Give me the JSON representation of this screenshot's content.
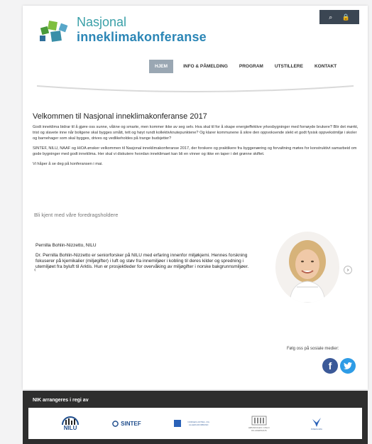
{
  "brand": {
    "line1": "Nasjonal",
    "line2": "inneklimakonferanse"
  },
  "utility": {
    "search_icon": "search-icon",
    "lock_icon": "lock-icon"
  },
  "nav": {
    "items": [
      {
        "label": "HJEM",
        "active": true
      },
      {
        "label": "INFO & PÅMELDING"
      },
      {
        "label": "PROGRAM"
      },
      {
        "label": "UTSTILLERE"
      },
      {
        "label": "KONTAKT"
      }
    ]
  },
  "content": {
    "heading": "Velkommen til Nasjonal inneklimakonferanse 2017",
    "paragraphs": [
      "Godt inneklima bidrar til å gjøre oss sunne, våkne og smarte, men kommer ikke av seg selv. Hva skal til for å skape energieffektive yrkesbygninger med fornøyde brukere? Blir det mørkt, trist og slavete inne når boligene skal bygges smått, tett og høyt rundt kollektivknutepunktene? Og klarer kommunene å sikre den oppvoksende slekt et godt fysisk oppvekstmiljø i skoler og barnehager som skal bygges, drives og vedlikeholdes på trange budsjetter?",
      "SINTEF, NILU, NAAF og HiOA ønsker velkommen til Nasjonal inneklimakonferanse 2017, der forskere og praktikere fra byggenæring og forvaltning møtes for konstruktivt samarbeid om gode bygninger med godt inneklima. Her skal vi diskutere hvordan inneklimaet kan bli en vinner og ikke en taper i det grønne skiftet.",
      "Vi håper å se deg på konferansen i mai."
    ]
  },
  "speakers": {
    "section_title": "Bli kjent med våre foredragsholdere",
    "current": {
      "name": "Pernilla Bohlin-Nizzetto, NILU",
      "bio": "Dr. Pernilla Bohlin-Nizzetto er seniorforsker på NILU med erfaring innenfor miljøkjemi. Hennes forskning fokuserer på kjemikalier (miljøgifter) i luft og støv fra innemiljøer i kobling til deres kilder og spredning i utemiljøet fra byluft til Arktis. Hun er prosjektleder for overvåking av miljøgifter i norske bakgrunnsmiljøer."
    },
    "prev_icon": "chevron-left-icon",
    "next_icon": "chevron-right-icon"
  },
  "social": {
    "label": "Følg oss på sosiale medier:",
    "facebook_icon": "facebook-icon",
    "twitter_icon": "twitter-icon"
  },
  "footer": {
    "title": "NIK arrangeres i regi av",
    "partners": [
      {
        "name": "NILU"
      },
      {
        "name": "SINTEF"
      },
      {
        "name": "NAAF",
        "sub": "NORGES ASTMA- OG ALLERGIFORBUND"
      },
      {
        "name": "HiOA",
        "sub": "HØGSKOLEN I OSLO OG AKERSHUS"
      },
      {
        "name": "KOMPETANSESENTER",
        "sub": "INNEKLIMA"
      }
    ]
  },
  "colors": {
    "accent": "#2b86b6",
    "nav_active": "#9aa7b3",
    "footer": "#2e2e2e"
  }
}
